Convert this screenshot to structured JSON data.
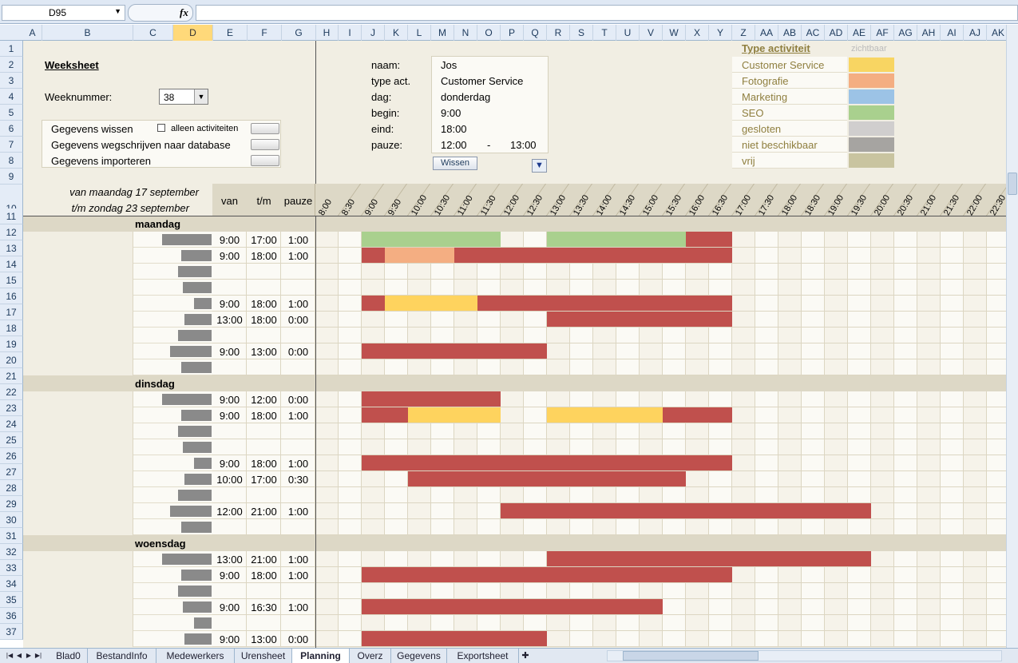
{
  "formula_bar": {
    "cell_ref": "D95",
    "fx": "fx",
    "formula": ""
  },
  "columns": [
    "A",
    "B",
    "C",
    "D",
    "E",
    "F",
    "G",
    "H",
    "I",
    "J",
    "K",
    "L",
    "M",
    "N",
    "O",
    "P",
    "Q",
    "R",
    "S",
    "T",
    "U",
    "V",
    "W",
    "X",
    "Y",
    "Z",
    "AA",
    "AB",
    "AC",
    "AD",
    "AE",
    "AF",
    "AG",
    "AH",
    "AI",
    "AJ",
    "AK"
  ],
  "selected_column": "D",
  "row_numbers": [
    "1",
    "2",
    "3",
    "4",
    "5",
    "6",
    "7",
    "8",
    "9",
    "10",
    "11",
    "12",
    "13",
    "14",
    "15",
    "16",
    "17",
    "18",
    "19",
    "20",
    "21",
    "22",
    "23",
    "24",
    "25",
    "26",
    "27",
    "28",
    "29",
    "30",
    "31",
    "32",
    "33",
    "34",
    "35",
    "36",
    "37"
  ],
  "weeksheet": {
    "title": "Weeksheet",
    "weeknummer_label": "Weeknummer:",
    "weeknummer_value": "38",
    "btn_wissen": "Gegevens wissen",
    "chk_label": "alleen activiteiten",
    "btn_wegschrijven": "Gegevens wegschrijven naar database",
    "btn_importeren": "Gegevens importeren"
  },
  "form": {
    "naam_label": "naam:",
    "naam": "Jos",
    "type_label": "type act.",
    "type": "Customer Service",
    "dag_label": "dag:",
    "dag": "donderdag",
    "begin_label": "begin:",
    "begin": "9:00",
    "eind_label": "eind:",
    "eind": "18:00",
    "pauze_label": "pauze:",
    "pauze_van": "12:00",
    "pauze_sep": "-",
    "pauze_tot": "13:00",
    "wissen": "Wissen"
  },
  "legend": {
    "title": "Type activiteit",
    "visible_header": "zichtbaar",
    "items": [
      {
        "label": "Customer Service",
        "color": "#f8d562"
      },
      {
        "label": "Fotografie",
        "color": "#f4ae82"
      },
      {
        "label": "Marketing",
        "color": "#9cc3e6"
      },
      {
        "label": "SEO",
        "color": "#a9d08e"
      },
      {
        "label": "gesloten",
        "color": "#d0cece"
      },
      {
        "label": "niet beschikbaar",
        "color": "#a6a4a1"
      },
      {
        "label": "vrij",
        "color": "#c9c4a0"
      }
    ]
  },
  "period": {
    "line1": "van maandag 17 september",
    "line2": "t/m zondag 23 september"
  },
  "headers": {
    "van": "van",
    "tm": "t/m",
    "pauze": "pauze"
  },
  "times": [
    "8:00",
    "8:30",
    "9:00",
    "9:30",
    "10:00",
    "10:30",
    "11:00",
    "11:30",
    "12:00",
    "12:30",
    "13:00",
    "13:30",
    "14:00",
    "14:30",
    "15:00",
    "15:30",
    "16:00",
    "16:30",
    "17:00",
    "17:30",
    "18:00",
    "18:30",
    "19:00",
    "19:30",
    "20:00",
    "20:30",
    "21:00",
    "21:30",
    "22:00",
    "22:30"
  ],
  "colors": {
    "work": "#c0504d",
    "cs": "#fed35e",
    "foto": "#f4ae82",
    "seo": "#a9d08e"
  },
  "schedule": [
    {
      "day": "maandag"
    },
    {
      "gray": 62,
      "van": "9:00",
      "tm": "17:00",
      "pauze": "1:00",
      "bars": [
        [
          2,
          8,
          "seo"
        ],
        [
          10,
          16,
          "seo"
        ],
        [
          16,
          18,
          "work"
        ]
      ]
    },
    {
      "gray": 38,
      "van": "9:00",
      "tm": "18:00",
      "pauze": "1:00",
      "bars": [
        [
          2,
          3,
          "work"
        ],
        [
          3,
          6,
          "foto"
        ],
        [
          6,
          18,
          "work"
        ]
      ]
    },
    {
      "gray": 42
    },
    {
      "gray": 36
    },
    {
      "gray": 22,
      "van": "9:00",
      "tm": "18:00",
      "pauze": "1:00",
      "bars": [
        [
          2,
          3,
          "work"
        ],
        [
          3,
          7,
          "cs"
        ],
        [
          7,
          18,
          "work"
        ]
      ]
    },
    {
      "gray": 34,
      "van": "13:00",
      "tm": "18:00",
      "pauze": "0:00",
      "bars": [
        [
          10,
          18,
          "work"
        ]
      ]
    },
    {
      "gray": 42
    },
    {
      "gray": 52,
      "van": "9:00",
      "tm": "13:00",
      "pauze": "0:00",
      "bars": [
        [
          2,
          10,
          "work"
        ]
      ]
    },
    {
      "gray": 38
    },
    {
      "day": "dinsdag"
    },
    {
      "gray": 62,
      "van": "9:00",
      "tm": "12:00",
      "pauze": "0:00",
      "bars": [
        [
          2,
          8,
          "work"
        ]
      ]
    },
    {
      "gray": 38,
      "van": "9:00",
      "tm": "18:00",
      "pauze": "1:00",
      "bars": [
        [
          2,
          4,
          "work"
        ],
        [
          4,
          8,
          "cs"
        ],
        [
          10,
          15,
          "cs"
        ],
        [
          15,
          18,
          "work"
        ]
      ]
    },
    {
      "gray": 42
    },
    {
      "gray": 36
    },
    {
      "gray": 22,
      "van": "9:00",
      "tm": "18:00",
      "pauze": "1:00",
      "bars": [
        [
          2,
          18,
          "work"
        ]
      ]
    },
    {
      "gray": 34,
      "van": "10:00",
      "tm": "17:00",
      "pauze": "0:30",
      "bars": [
        [
          4,
          16,
          "work"
        ]
      ]
    },
    {
      "gray": 42
    },
    {
      "gray": 52,
      "van": "12:00",
      "tm": "21:00",
      "pauze": "1:00",
      "bars": [
        [
          8,
          24,
          "work"
        ]
      ]
    },
    {
      "gray": 38
    },
    {
      "day": "woensdag"
    },
    {
      "gray": 62,
      "van": "13:00",
      "tm": "21:00",
      "pauze": "1:00",
      "bars": [
        [
          10,
          24,
          "work"
        ]
      ]
    },
    {
      "gray": 38,
      "van": "9:00",
      "tm": "18:00",
      "pauze": "1:00",
      "bars": [
        [
          2,
          18,
          "work"
        ]
      ]
    },
    {
      "gray": 42
    },
    {
      "gray": 36,
      "van": "9:00",
      "tm": "16:30",
      "pauze": "1:00",
      "bars": [
        [
          2,
          15,
          "work"
        ]
      ]
    },
    {
      "gray": 22
    },
    {
      "gray": 34,
      "van": "9:00",
      "tm": "13:00",
      "pauze": "0:00",
      "bars": [
        [
          2,
          10,
          "work"
        ]
      ]
    }
  ],
  "tabs": [
    "Blad0",
    "BestandInfo",
    "Medewerkers",
    "Urensheet",
    "Planning",
    "Overz",
    "Gegevens",
    "Exportsheet"
  ],
  "active_tab": "Planning",
  "tab_nav": [
    "|◀",
    "◀",
    "▶",
    "▶|"
  ]
}
